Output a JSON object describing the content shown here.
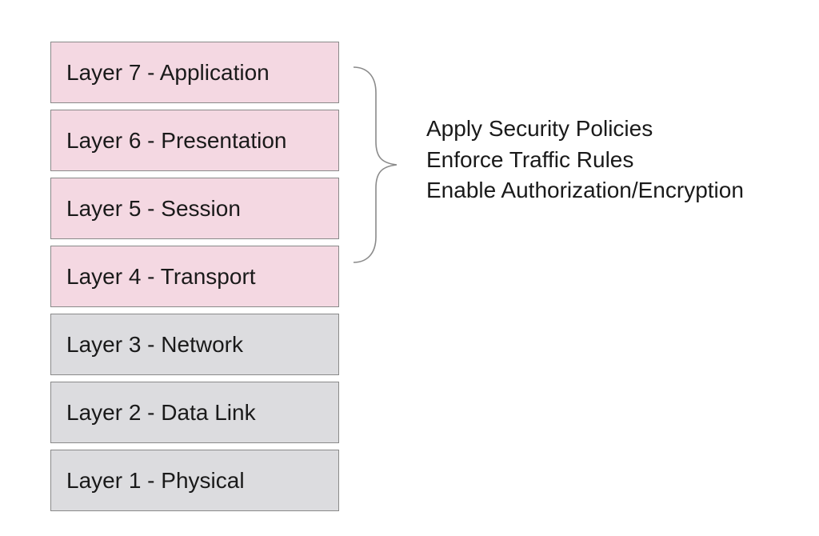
{
  "layers": [
    {
      "label": "Layer 7 - Application",
      "group": "upper"
    },
    {
      "label": "Layer 6 - Presentation",
      "group": "upper"
    },
    {
      "label": "Layer 5 - Session",
      "group": "upper"
    },
    {
      "label": "Layer 4 - Transport",
      "group": "upper"
    },
    {
      "label": "Layer 3 - Network",
      "group": "lower"
    },
    {
      "label": "Layer 2 - Data Link",
      "group": "lower"
    },
    {
      "label": "Layer 1 - Physical",
      "group": "lower"
    }
  ],
  "annotations": [
    "Apply Security Policies",
    "Enforce Traffic Rules",
    "Enable Authorization/Encryption"
  ],
  "colors": {
    "upper_fill": "#f4d8e2",
    "lower_fill": "#dcdcdf",
    "border": "#8a8a8a",
    "brace": "#8a8a8a",
    "text": "#1a1a1a"
  }
}
